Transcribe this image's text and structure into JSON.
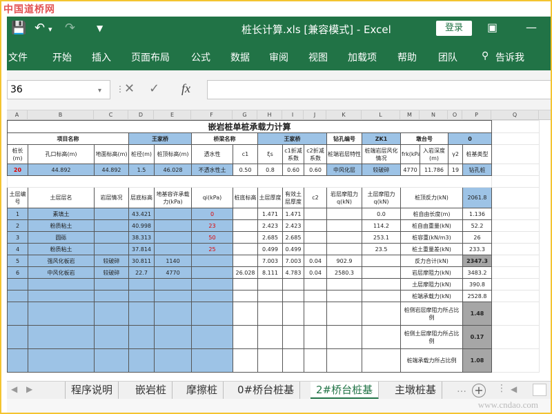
{
  "watermark_top": "中国道桥网",
  "watermark_bottom": "www.cndao.com",
  "window": {
    "title": "桩长计算.xls [兼容模式] - Excel",
    "login": "登录"
  },
  "ribbon": {
    "tabs": [
      "文件",
      "开始",
      "插入",
      "页面布局",
      "公式",
      "数据",
      "审阅",
      "视图",
      "加载项",
      "帮助",
      "团队",
      "告诉我"
    ]
  },
  "formula_bar": {
    "name_box": "36",
    "fx": "fx"
  },
  "columns": [
    "A",
    "B",
    "C",
    "D",
    "E",
    "F",
    "G",
    "H",
    "I",
    "J",
    "K",
    "L",
    "M",
    "N",
    "O",
    "P",
    "Q"
  ],
  "rows": [
    [
      "嵌岩桩单桩承载力计算"
    ],
    [
      "项目名称",
      "王家桥",
      "桥梁名称",
      "王家桥",
      "钻孔编号",
      "ZK1",
      "墩台号",
      "0"
    ],
    [
      "桩长(m)",
      "孔口标高(m)",
      "地面标高(m)",
      "桩径(m)",
      "桩顶标高(m)",
      "透水性",
      "c1",
      "ξs",
      "c1折减系数",
      "c2折减系数",
      "桩端岩层特性",
      "桩端岩层风化情况",
      "frk(kPa)",
      "入岩深度(m)",
      "γ2",
      "桩基类型"
    ],
    [
      "20",
      "44.892",
      "44.892",
      "1.5",
      "46.028",
      "不透水性土",
      "0.50",
      "0.8",
      "0.60",
      "0.60",
      "中风化层",
      "较破碎",
      "4770",
      "11.786",
      "19",
      "钻孔桩"
    ],
    [
      "土层编号",
      "土层层名",
      "岩层情况",
      "层底标高",
      "地基容许承载力(kPa)",
      "qi(kPa)",
      "桩底标高",
      "土层厚度",
      "有效土层厚度",
      "c2",
      "岩层摩阻力q(kN)",
      "土层摩阻力q(kN)",
      "桩顶反力(kN)",
      "2061.8"
    ],
    [
      "1",
      "素填土",
      "",
      "43.421",
      "",
      "0",
      "",
      "1.471",
      "1.471",
      "",
      "",
      "0.0",
      "桩自由长度(m)",
      "1.136"
    ],
    [
      "2",
      "粉质粘土",
      "",
      "40.998",
      "",
      "23",
      "",
      "2.423",
      "2.423",
      "",
      "",
      "114.2",
      "桩自由重量(kN)",
      "52.2"
    ],
    [
      "3",
      "圆砾",
      "",
      "38.313",
      "",
      "50",
      "",
      "2.685",
      "2.685",
      "",
      "",
      "253.1",
      "桩容重(kN/m3)",
      "26"
    ],
    [
      "4",
      "粉质粘土",
      "",
      "37.814",
      "",
      "25",
      "",
      "0.499",
      "0.499",
      "",
      "",
      "23.5",
      "桩土重量差(kN)",
      "233.3"
    ],
    [
      "5",
      "强风化板岩",
      "较破碎",
      "30.811",
      "1140",
      "",
      "",
      "7.003",
      "7.003",
      "0.04",
      "902.9",
      "",
      "反力合计(kN)",
      "2347.3"
    ],
    [
      "6",
      "中风化板岩",
      "较破碎",
      "22.7",
      "4770",
      "",
      "26.028",
      "8.111",
      "4.783",
      "0.04",
      "2580.3",
      "",
      "岩层摩阻力(kN)",
      "3483.2"
    ],
    [
      "土层摩阻力(kN)",
      "390.8"
    ],
    [
      "桩端承载力(kN)",
      "2528.8"
    ],
    [
      "桩侧岩层摩阻力所占比例",
      "1.48"
    ],
    [
      "桩侧土层摩阻力所占比例",
      "0.17"
    ],
    [
      "桩端承载力所占比例",
      "1.08"
    ]
  ],
  "sheet_tabs": [
    "程序说明",
    "嵌岩桩",
    "摩擦桩",
    "0#桥台桩基",
    "2#桥台桩基",
    "主墩桩基"
  ],
  "active_tab": "2#桥台桩基",
  "colors": {
    "excel_green": "#217346",
    "cell_blue": "#9dc3e6",
    "cell_gray": "#a6a6a6",
    "red": "#e00000"
  }
}
